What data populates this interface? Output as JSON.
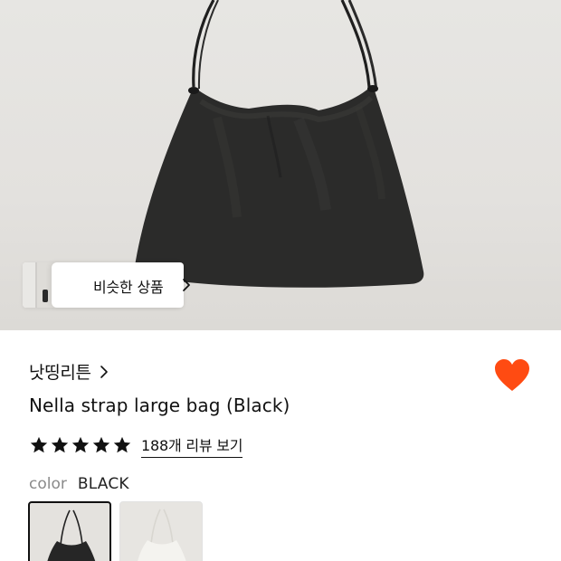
{
  "similar_products": {
    "label": "비슷한 상품"
  },
  "product": {
    "brand": "낫띵리튼",
    "title": "Nella strap large bag (Black)",
    "rating": {
      "stars": 5,
      "review_link": "188개 리뷰 보기"
    },
    "wishlisted": true,
    "color": {
      "label": "color",
      "value": "BLACK"
    },
    "swatches": [
      {
        "name": "black",
        "selected": true
      },
      {
        "name": "white",
        "selected": false
      }
    ]
  },
  "colors": {
    "heart": "#ff4b12",
    "text": "#111111",
    "muted": "#8a8a8a",
    "bag": "#2b2b2a"
  },
  "icons": {
    "similar_chevron": "chevron-right-icon",
    "brand_chevron": "chevron-right-icon",
    "wishlist": "heart-icon",
    "rating": "star-icon"
  }
}
